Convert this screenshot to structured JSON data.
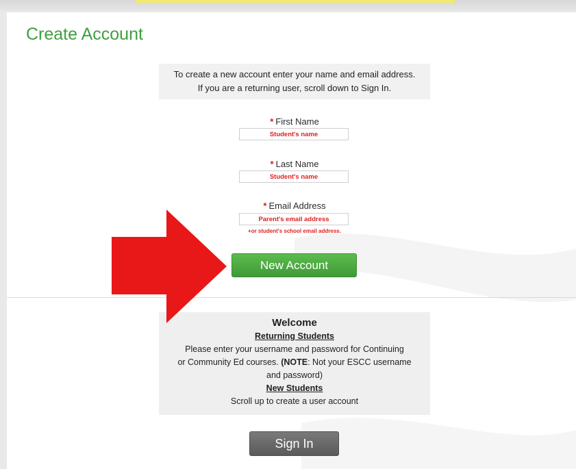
{
  "page": {
    "title": "Create Account"
  },
  "intro": {
    "line1": "To create a new account enter your name and email address.",
    "line2": "If you are a returning user, scroll down to Sign In."
  },
  "form": {
    "required_marker": "*",
    "first_name": {
      "label": "First Name",
      "placeholder": "Student's name",
      "value": ""
    },
    "last_name": {
      "label": "Last Name",
      "placeholder": "Student's name",
      "value": ""
    },
    "email": {
      "label": "Email Address",
      "placeholder": "Parent's email address",
      "value": "",
      "note": "+or student's school email address."
    },
    "submit_label": "New Account"
  },
  "welcome": {
    "title": "Welcome",
    "returning_heading": "Returning Students",
    "returning_text_1": "Please enter your username and password for Continuing",
    "returning_text_2a": "or Community Ed courses. ",
    "note_open": "(",
    "note_label": "NOTE",
    "returning_text_2b": ": Not your ESCC username",
    "returning_text_3": "and password)",
    "new_heading": "New Students",
    "new_text": "Scroll up to create a user account"
  },
  "signin": {
    "label": "Sign In"
  },
  "colors": {
    "title_green": "#3f9f3f",
    "button_green": "#4caf45",
    "required_red": "#d11f1f",
    "arrow_red": "#e81818",
    "signin_gray": "#656565"
  },
  "icons": {
    "annotation_arrow": "red-right-arrow"
  }
}
